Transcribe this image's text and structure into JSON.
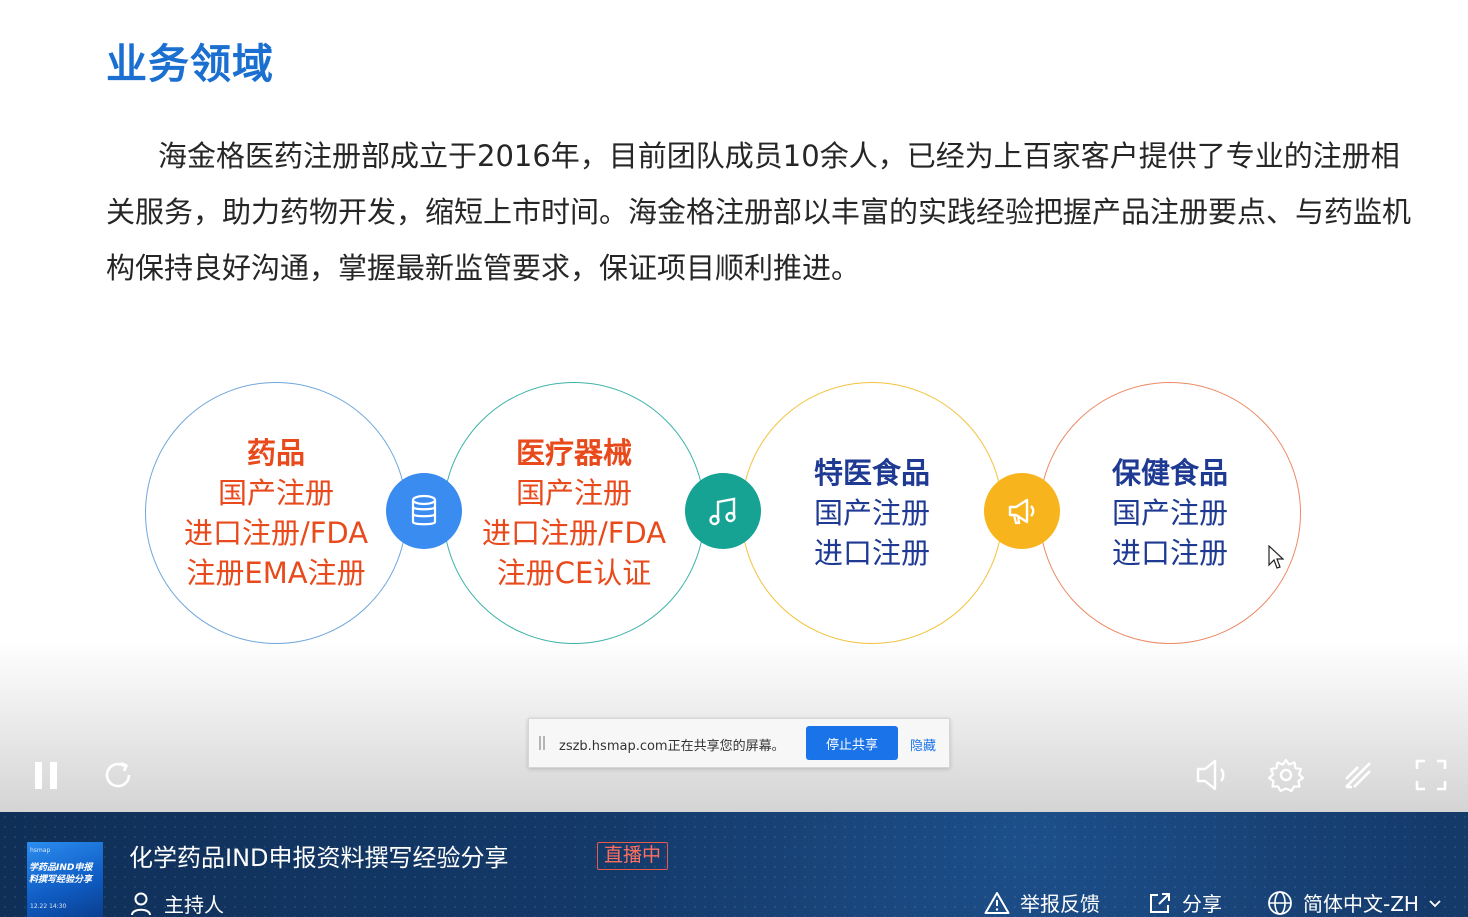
{
  "slide": {
    "title": "业务领域",
    "intro": "海金格医药注册部成立于2016年，目前团队成员10余人，已经为上百家客户提供了专业的注册相关服务，助力药物开发，缩短上市时间。海金格注册部以丰富的实践经验把握产品注册要点、与药监机构保持良好沟通，掌握最新监管要求，保证项目顺利推进。",
    "cards": [
      {
        "head": "药品",
        "lines": [
          "国产注册",
          "进口注册/FDA",
          "注册EMA注册"
        ],
        "color": "#e84a1c",
        "ring": "#6fa7dc"
      },
      {
        "head": "医疗器械",
        "lines": [
          "国产注册",
          "进口注册/FDA",
          "注册CE认证"
        ],
        "color": "#e84a1c",
        "ring": "#3fb3a9"
      },
      {
        "head": "特医食品",
        "lines": [
          "国产注册",
          "进口注册"
        ],
        "color": "#1f3a93",
        "ring": "#f3c23d"
      },
      {
        "head": "保健食品",
        "lines": [
          "国产注册",
          "进口注册"
        ],
        "color": "#1f3a93",
        "ring": "#ec8a66"
      }
    ],
    "connectors": [
      {
        "icon": "database-icon",
        "color": "#3a8cf0"
      },
      {
        "icon": "music-note-icon",
        "color": "#16a394"
      },
      {
        "icon": "megaphone-icon",
        "color": "#f8b41d"
      }
    ]
  },
  "share_bar": {
    "message": "zszb.hsmap.com正在共享您的屏幕。",
    "stop_label": "停止共享",
    "hide_label": "隐藏"
  },
  "player": {
    "controls": [
      "pause-icon",
      "refresh-icon",
      "volume-icon",
      "settings-icon",
      "danmaku-off-icon",
      "fullscreen-icon"
    ]
  },
  "infobar": {
    "thumbnail": {
      "top": "hsmap",
      "main": "学药品IND申报料撰写经验分享",
      "bottom": "12.22 14:30"
    },
    "title": "化学药品IND申报资料撰写经验分享",
    "live_badge": "直播中",
    "host_label": "主持人",
    "report_label": "举报反馈",
    "share_label": "分享",
    "language_label": "简体中文-ZH"
  }
}
